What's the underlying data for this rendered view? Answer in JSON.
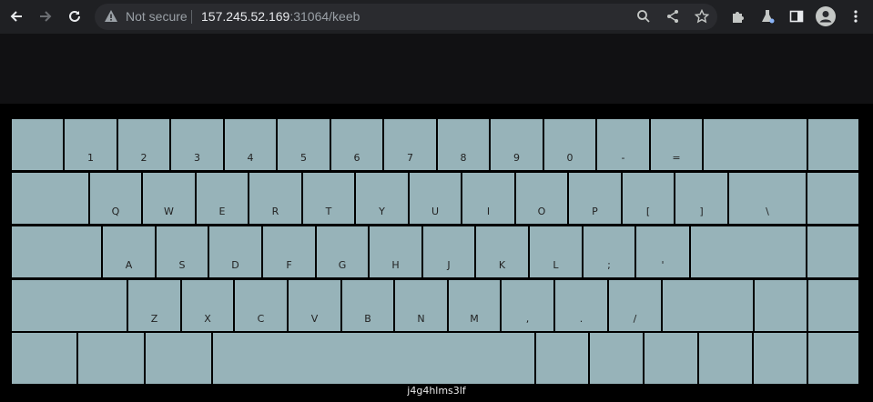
{
  "browser": {
    "security": "Not secure",
    "url_host": "157.245.52.169",
    "url_rest": ":31064/keeb"
  },
  "keyboard": {
    "rows": [
      [
        "",
        "1",
        "2",
        "3",
        "4",
        "5",
        "6",
        "7",
        "8",
        "9",
        "0",
        "-",
        "=",
        "",
        ""
      ],
      [
        "",
        "Q",
        "W",
        "E",
        "R",
        "T",
        "Y",
        "U",
        "I",
        "O",
        "P",
        "[",
        "]",
        "\\",
        ""
      ],
      [
        "",
        "A",
        "S",
        "D",
        "F",
        "G",
        "H",
        "J",
        "K",
        "L",
        ";",
        "'",
        "",
        ""
      ],
      [
        "",
        "Z",
        "X",
        "C",
        "V",
        "B",
        "N",
        "M",
        ",",
        ".",
        "/",
        "",
        "",
        ""
      ],
      [
        "",
        "",
        "",
        "",
        "",
        "",
        "",
        "",
        ""
      ]
    ]
  },
  "footer_text": "j4g4hlms3lf"
}
